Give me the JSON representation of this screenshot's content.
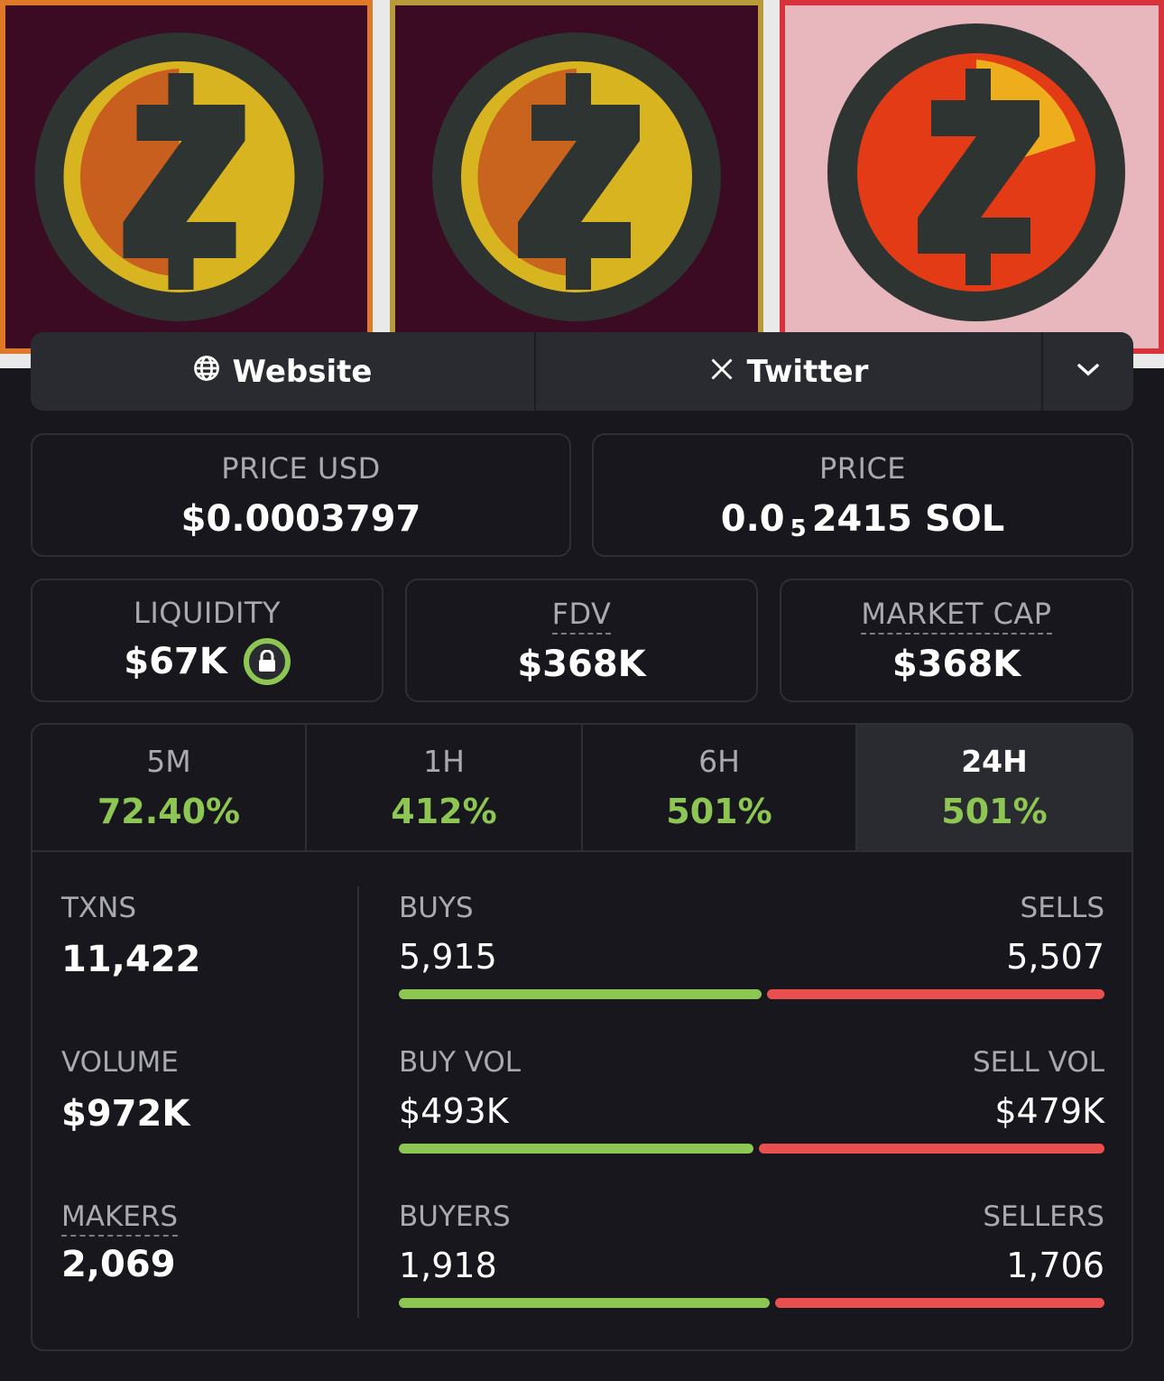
{
  "colors": {
    "background": "#17171d",
    "green": "#8ec653",
    "red": "#ea4f4f",
    "muted": "#a9aab0"
  },
  "links": {
    "website_label": "Website",
    "twitter_label": "Twitter",
    "website_icon": "globe-icon",
    "twitter_icon": "x-logo-icon",
    "more_icon": "chevron-down-icon"
  },
  "prices": {
    "usd_label": "PRICE USD",
    "usd_value": "$0.0003797",
    "native_label": "PRICE",
    "native_prefix": "0.0",
    "native_subscript": "5",
    "native_rest": "2415 SOL"
  },
  "metrics": {
    "liquidity_label": "LIQUIDITY",
    "liquidity_value": "$67K",
    "liquidity_icon": "lock-icon",
    "fdv_label": "FDV",
    "fdv_value": "$368K",
    "mcap_label": "MARKET CAP",
    "mcap_value": "$368K"
  },
  "periods": [
    {
      "label": "5M",
      "value": "72.40%",
      "active": false
    },
    {
      "label": "1H",
      "value": "412%",
      "active": false
    },
    {
      "label": "6H",
      "value": "501%",
      "active": false
    },
    {
      "label": "24H",
      "value": "501%",
      "active": true
    }
  ],
  "stats": {
    "txns_label": "TXNS",
    "txns_value": "11,422",
    "volume_label": "VOLUME",
    "volume_value": "$972K",
    "makers_label": "MAKERS",
    "makers_value": "2,069",
    "buys_label": "BUYS",
    "buys_value": "5,915",
    "sells_label": "SELLS",
    "sells_value": "5,507",
    "buys_ratio": 0.518,
    "buy_vol_label": "BUY VOL",
    "buy_vol_value": "$493K",
    "sell_vol_label": "SELL VOL",
    "sell_vol_value": "$479K",
    "buy_vol_ratio": 0.507,
    "buyers_label": "BUYERS",
    "buyers_value": "1,918",
    "sellers_label": "SELLERS",
    "sellers_value": "1,706",
    "buyers_ratio": 0.529
  }
}
